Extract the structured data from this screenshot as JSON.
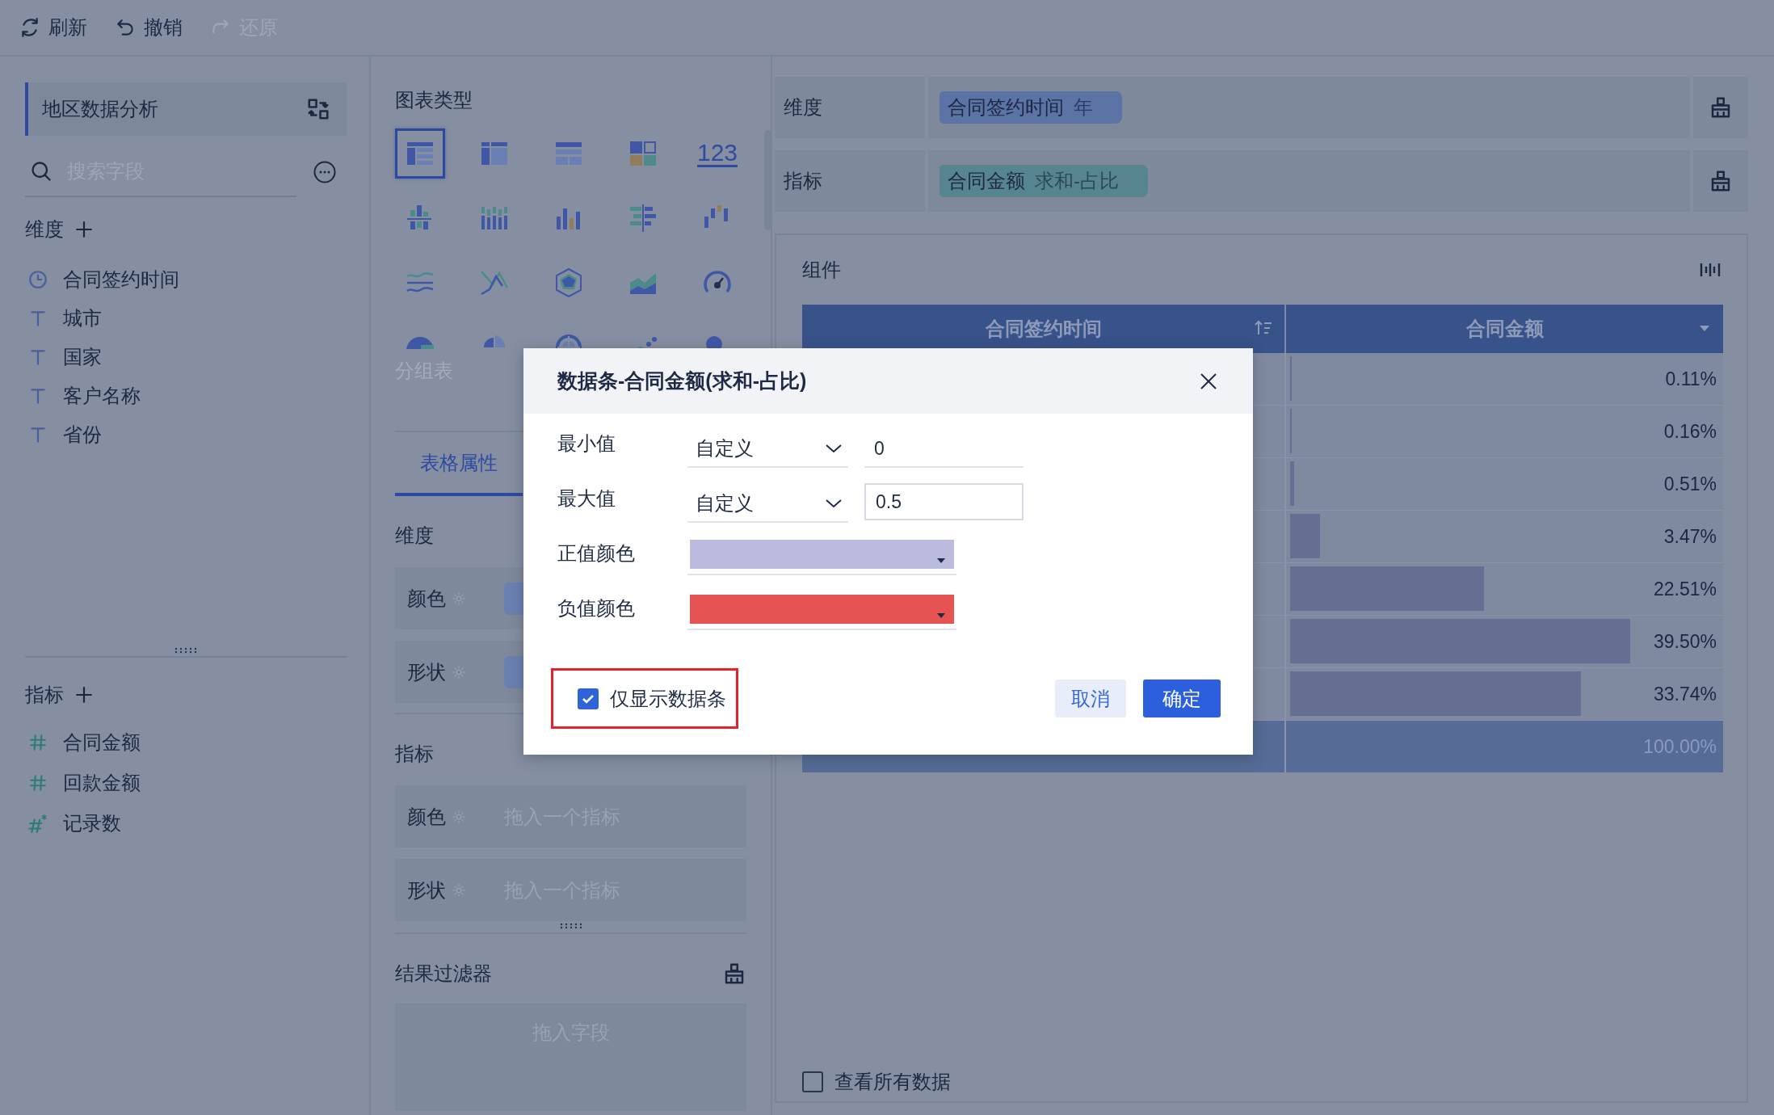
{
  "toolbar": [
    {
      "label": "刷新",
      "disabled": false
    },
    {
      "label": "撤销",
      "disabled": false
    },
    {
      "label": "还原",
      "disabled": true
    }
  ],
  "dataset": {
    "title": "地区数据分析"
  },
  "field_search": {
    "placeholder": "搜索字段"
  },
  "dimensions": {
    "title": "维度",
    "fields": [
      {
        "name": "合同签约时间",
        "kind": "date"
      },
      {
        "name": "城市",
        "kind": "text"
      },
      {
        "name": "国家",
        "kind": "text"
      },
      {
        "name": "客户名称",
        "kind": "text"
      },
      {
        "name": "省份",
        "kind": "text"
      }
    ]
  },
  "measures": {
    "title": "指标",
    "fields": [
      {
        "name": "合同金额",
        "kind": "number"
      },
      {
        "name": "回款金额",
        "kind": "number"
      },
      {
        "name": "记录数",
        "kind": "count"
      }
    ]
  },
  "chart_types": {
    "title": "图表类型",
    "hover_label": "分组表",
    "items": [
      {
        "kind": "table",
        "selected": true
      },
      {
        "kind": "crosstab",
        "selected": false
      },
      {
        "kind": "detail",
        "selected": false
      },
      {
        "kind": "blocks",
        "selected": false
      },
      {
        "kind": "number",
        "label": "123",
        "selected": false
      },
      {
        "kind": "grouped",
        "selected": false
      },
      {
        "kind": "stacked",
        "selected": false
      },
      {
        "kind": "column",
        "selected": false
      },
      {
        "kind": "bar",
        "selected": false
      },
      {
        "kind": "waterfall",
        "selected": false
      },
      {
        "kind": "wave",
        "selected": false
      },
      {
        "kind": "line",
        "selected": false
      },
      {
        "kind": "radar",
        "selected": false
      },
      {
        "kind": "area",
        "selected": false
      },
      {
        "kind": "gauge",
        "selected": false
      },
      {
        "kind": "pie",
        "selected": false
      },
      {
        "kind": "rose",
        "selected": false
      },
      {
        "kind": "ring",
        "selected": false
      },
      {
        "kind": "scatter",
        "selected": false
      },
      {
        "kind": "bubble",
        "selected": false
      }
    ]
  },
  "properties": {
    "tabs": [
      {
        "label": "表格属性",
        "selected": true
      }
    ],
    "sections": [
      {
        "title": "维度",
        "slots": [
          {
            "label": "颜色",
            "kind": "chip"
          },
          {
            "label": "形状",
            "kind": "chip"
          }
        ]
      },
      {
        "title": "指标",
        "slots": [
          {
            "label": "颜色",
            "kind": "empty",
            "placeholder": "拖入一个指标"
          },
          {
            "label": "形状",
            "kind": "empty",
            "placeholder": "拖入一个指标"
          }
        ]
      }
    ]
  },
  "result_filter": {
    "title": "结果过滤器",
    "placeholder": "拖入字段"
  },
  "shelves": [
    {
      "label": "维度",
      "chip": {
        "name": "合同签约时间",
        "suffix": "年",
        "kind": "dimension"
      }
    },
    {
      "label": "指标",
      "chip": {
        "name": "合同金额",
        "suffix": "求和-占比",
        "kind": "measure"
      }
    }
  ],
  "component": {
    "title": "组件",
    "table": {
      "columns": [
        {
          "label": "合同签约时间"
        },
        {
          "label": "合同金额"
        }
      ],
      "rows": [
        {
          "value": "0.11%",
          "level": 0.0022
        },
        {
          "value": "0.16%",
          "level": 0.0032
        },
        {
          "value": "0.51%",
          "level": 0.0102
        },
        {
          "value": "3.47%",
          "level": 0.0694
        },
        {
          "value": "22.51%",
          "level": 0.4502
        },
        {
          "value": "39.50%",
          "level": 0.79
        },
        {
          "value": "33.74%",
          "level": 0.6748
        }
      ],
      "total": "100.00%"
    }
  },
  "show_all_data": {
    "label": "查看所有数据",
    "checked": false
  },
  "dialog": {
    "title": "数据条-合同金额(求和-占比)",
    "limits": [
      {
        "label": "最小值",
        "mode": "自定义",
        "value": "0",
        "focused": false
      },
      {
        "label": "最大值",
        "mode": "自定义",
        "value": "0.5",
        "focused": true
      }
    ],
    "colors": [
      {
        "label": "正值颜色",
        "color": "#bbbbdd"
      },
      {
        "label": "负值颜色",
        "color": "#e55353"
      }
    ],
    "only_bars": {
      "label": "仅显示数据条",
      "checked": true,
      "highlighted": true
    },
    "buttons": [
      {
        "label": "取消",
        "kind": "secondary"
      },
      {
        "label": "确定",
        "kind": "primary"
      }
    ]
  }
}
